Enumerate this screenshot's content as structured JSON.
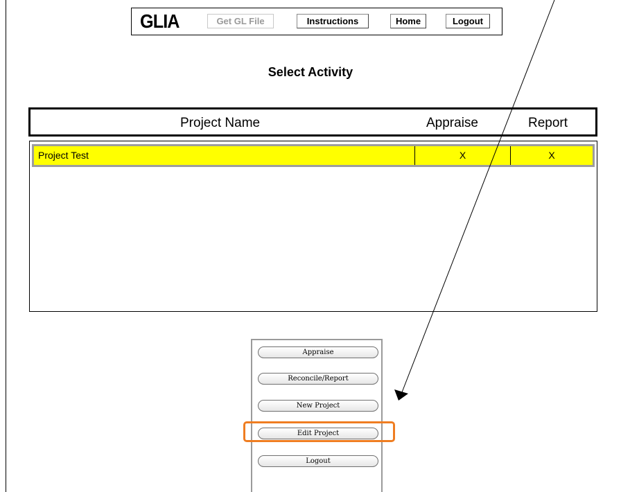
{
  "nav": {
    "logo": "GLIA",
    "buttons": {
      "get_gl_file": "Get GL File",
      "instructions": "Instructions",
      "home": "Home",
      "logout": "Logout"
    }
  },
  "page": {
    "title": "Select Activity"
  },
  "table": {
    "headers": {
      "project_name": "Project Name",
      "appraise": "Appraise",
      "report": "Report"
    },
    "rows": [
      {
        "name": "Project Test",
        "appraise": "X",
        "report": "X",
        "highlight_color": "#ffff00"
      }
    ]
  },
  "actions": {
    "appraise": "Appraise",
    "reconcile_report": "Reconcile/Report",
    "new_project": "New Project",
    "edit_project": "Edit Project",
    "logout": "Logout"
  },
  "colors": {
    "highlight": "#ef7d21",
    "selected_row": "#ffff00"
  }
}
